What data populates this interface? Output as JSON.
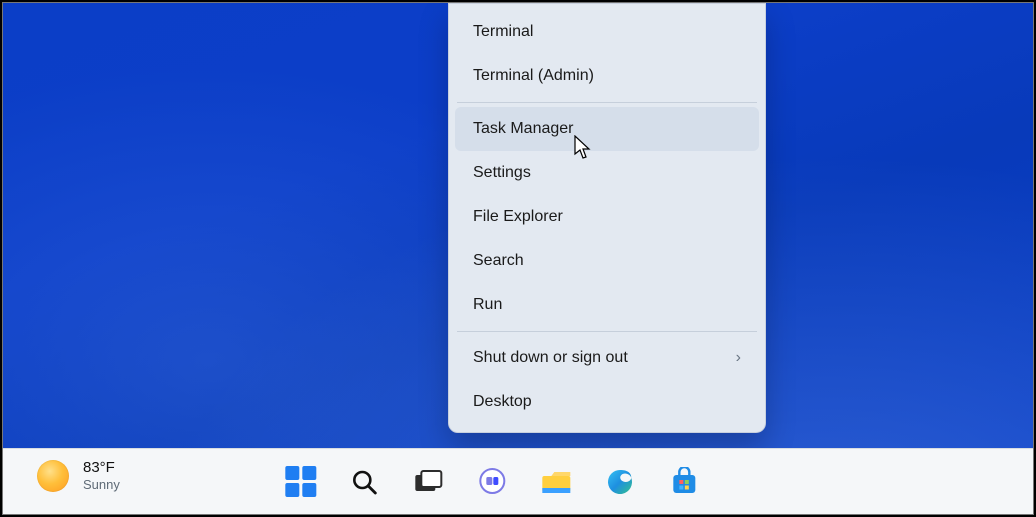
{
  "weather": {
    "temp": "83°F",
    "cond": "Sunny"
  },
  "ctx": {
    "terminal": "Terminal",
    "terminalAdmin": "Terminal (Admin)",
    "taskManager": "Task Manager",
    "settings": "Settings",
    "fileExplorer": "File Explorer",
    "search": "Search",
    "run": "Run",
    "shutdown": "Shut down or sign out",
    "desktop": "Desktop"
  }
}
